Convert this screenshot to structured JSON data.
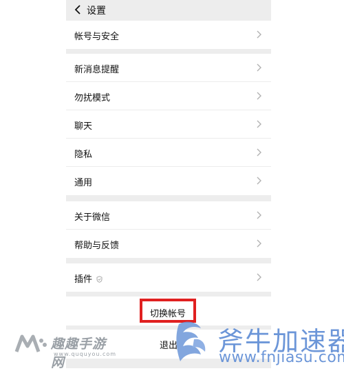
{
  "header": {
    "title": "设置",
    "back_icon": "chevron-left-icon"
  },
  "groups": [
    {
      "items": [
        {
          "label": "帐号与安全"
        }
      ]
    },
    {
      "items": [
        {
          "label": "新消息提醒"
        },
        {
          "label": "勿扰模式"
        },
        {
          "label": "聊天"
        },
        {
          "label": "隐私"
        },
        {
          "label": "通用"
        }
      ]
    },
    {
      "items": [
        {
          "label": "关于微信"
        },
        {
          "label": "帮助与反馈"
        }
      ]
    },
    {
      "items": [
        {
          "label": "插件",
          "icon": "shield-icon"
        }
      ]
    }
  ],
  "actions": {
    "switch_account": "切换帐号",
    "logout": "退出"
  },
  "highlight_color": "#e02020",
  "watermarks": {
    "left_name": "趣趣手游网",
    "left_url": "www.ququyou.com",
    "right_name": "斧牛加速器",
    "right_url": "www.fnjiasu.com"
  }
}
